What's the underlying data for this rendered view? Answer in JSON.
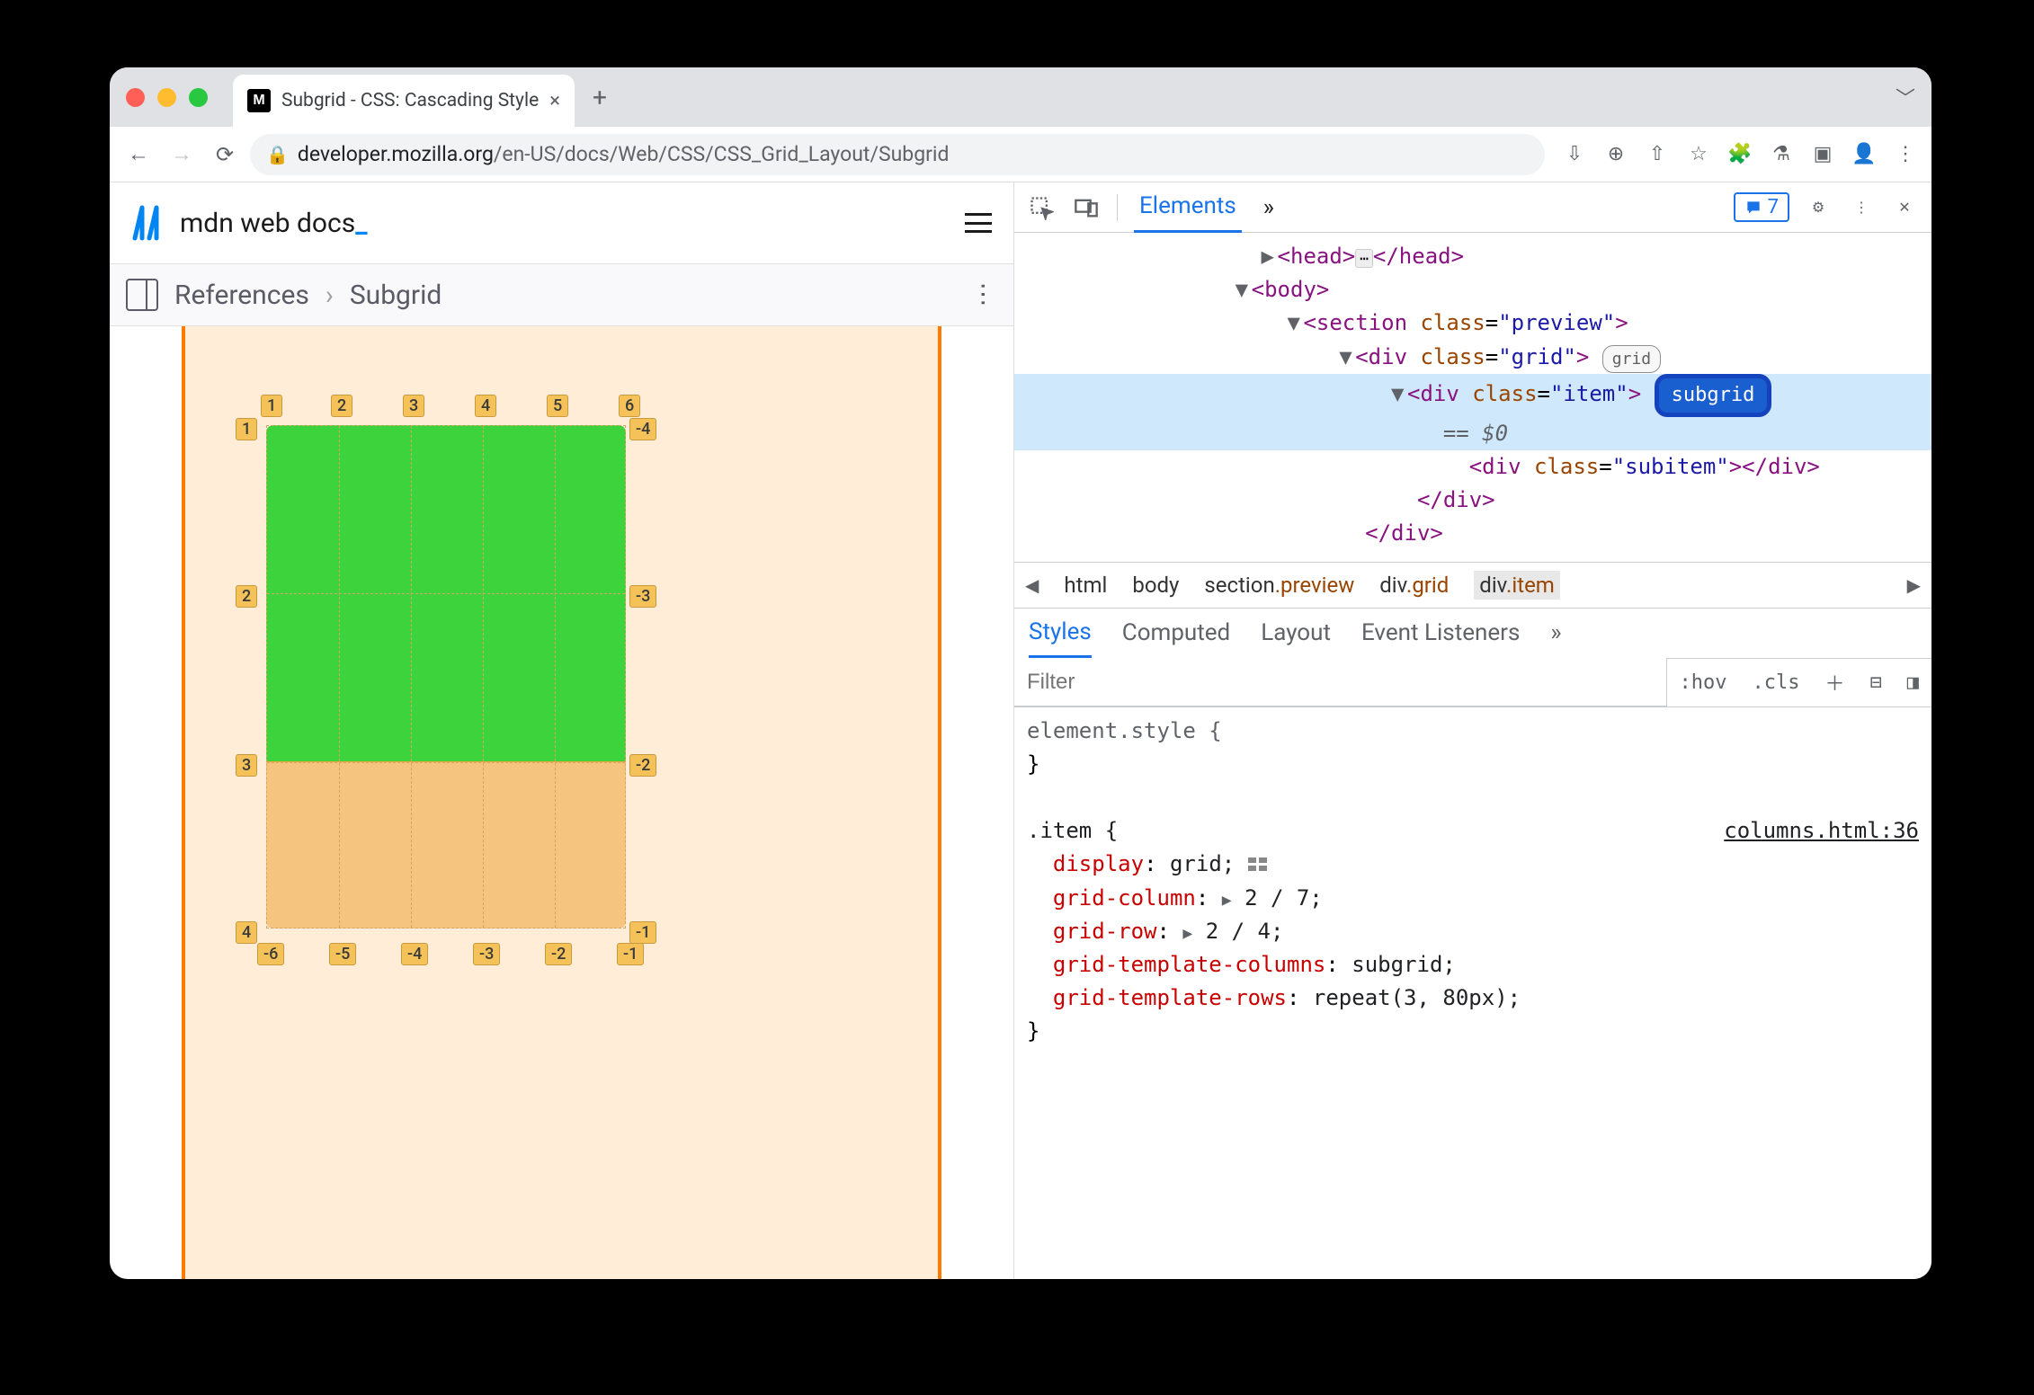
{
  "chrome": {
    "tab_title": "Subgrid - CSS: Cascading Style",
    "tab_favicon": "M",
    "url_domain": "developer.mozilla.org",
    "url_path": "/en-US/docs/Web/CSS/CSS_Grid_Layout/Subgrid"
  },
  "mdn": {
    "logo_text": "mdn web docs",
    "underscore": "_",
    "breadcrumb": {
      "root": "References",
      "current": "Subgrid"
    }
  },
  "grid_preview": {
    "top_labels": [
      "1",
      "2",
      "3",
      "4",
      "5",
      "6"
    ],
    "left_labels": [
      "1",
      "2",
      "3",
      "4"
    ],
    "right_labels": [
      "-4",
      "-3",
      "-2",
      "-1"
    ],
    "bottom_labels": [
      "-6",
      "-5",
      "-4",
      "-3",
      "-2",
      "-1"
    ]
  },
  "devtools": {
    "tabs": {
      "elements": "Elements",
      "more": "»"
    },
    "issues": "7",
    "dom": {
      "head": "<head>…</head>",
      "body": "<body>",
      "section": "<section class=\"preview\">",
      "div_grid": "<div class=\"grid\">",
      "grid_badge": "grid",
      "div_item": "<div class=\"item\">",
      "subgrid_badge": "subgrid",
      "eq0": "== $0",
      "subitem": "<div class=\"subitem\"></div>",
      "close_item": "</div>",
      "close_grid": "</div>"
    },
    "path": [
      "html",
      "body",
      "section.preview",
      "div.grid",
      "div.item"
    ],
    "styles_tabs": [
      "Styles",
      "Computed",
      "Layout",
      "Event Listeners",
      "»"
    ],
    "filter_placeholder": "Filter",
    "hov": ":hov",
    "cls": ".cls",
    "styles": {
      "element_style": "element.style {",
      "close": "}",
      "selector": ".item {",
      "src": "columns.html:36",
      "rules": [
        {
          "p": "display",
          "v": "grid;"
        },
        {
          "p": "grid-column",
          "v": "2 / 7;",
          "tri": true
        },
        {
          "p": "grid-row",
          "v": "2 / 4;",
          "tri": true
        },
        {
          "p": "grid-template-columns",
          "v": "subgrid;"
        },
        {
          "p": "grid-template-rows",
          "v": "repeat(3, 80px);"
        }
      ]
    }
  }
}
